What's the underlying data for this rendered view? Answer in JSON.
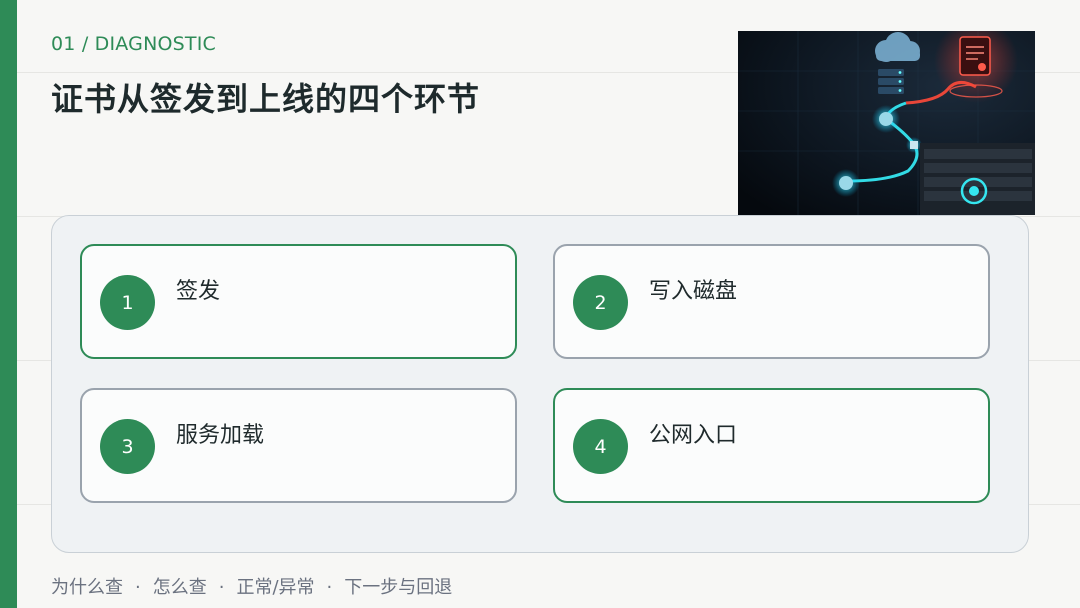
{
  "header": {
    "eyebrow": "01 / DIAGNOSTIC",
    "title": "证书从签发到上线的四个环节"
  },
  "hero_image": {
    "icon": "cloud-server-certificate-illustration"
  },
  "steps": [
    {
      "number": "1",
      "label": "签发",
      "highlighted": true
    },
    {
      "number": "2",
      "label": "写入磁盘",
      "highlighted": false
    },
    {
      "number": "3",
      "label": "服务加载",
      "highlighted": false
    },
    {
      "number": "4",
      "label": "公网入口",
      "highlighted": true
    }
  ],
  "footer": {
    "items": [
      "为什么查",
      "怎么查",
      "正常/异常",
      "下一步与回退"
    ],
    "separator": "·"
  },
  "colors": {
    "accent": "#2e8b57",
    "card_border": "#9aa3ad",
    "panel_bg": "#eff2f4",
    "page_bg": "#f7f7f5"
  }
}
